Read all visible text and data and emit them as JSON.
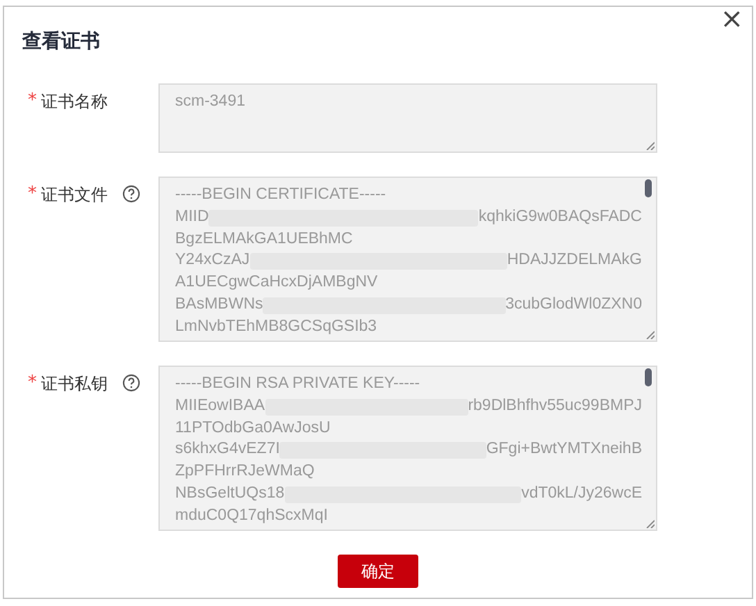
{
  "dialog": {
    "title": "查看证书",
    "close": "×"
  },
  "fields": [
    {
      "label": "证书名称",
      "required_mark": "*",
      "help": false,
      "scrollable": false,
      "lines": [
        {
          "head": "scm-3491"
        }
      ]
    },
    {
      "label": "证书文件",
      "required_mark": "*",
      "help": true,
      "scrollable": true,
      "lines": [
        {
          "head": "-----BEGIN CERTIFICATE-----"
        },
        {
          "head": "MIID",
          "tail": "kqhkiG9w0BAQsFADC"
        },
        {
          "head": "BgzELMAkGA1UEBhMC"
        },
        {
          "head": "Y24xCzAJ",
          "tail": "HDAJJZDELMAkG"
        },
        {
          "head": "A1UECgwCaHcxDjAMBgNV"
        },
        {
          "head": "BAsMBWNs",
          "tail": "3cubGlodWl0ZXN0"
        },
        {
          "head": "LmNvbTEhMB8GCSqGSIb3"
        }
      ]
    },
    {
      "label": "证书私钥",
      "required_mark": "*",
      "help": true,
      "scrollable": true,
      "lines": [
        {
          "head": "-----BEGIN RSA PRIVATE KEY-----"
        },
        {
          "head": "MIIEowIBAA",
          "tail": "rb9DlBhfhv55uc99BMPJ"
        },
        {
          "head": "11PTOdbGa0AwJosU"
        },
        {
          "head": "s6khxG4vEZ7I",
          "tail": "GFgi+BwtYMTXneihB"
        },
        {
          "head": "ZpPFHrrRJeWMaQ"
        },
        {
          "head": "NBsGeltUQs18",
          "tail": "vdT0kL/Jy26wcE"
        },
        {
          "head": "mduC0Q17qhScxMqI"
        }
      ]
    }
  ],
  "buttons": [
    {
      "label": "确定",
      "kind": "primary"
    }
  ]
}
